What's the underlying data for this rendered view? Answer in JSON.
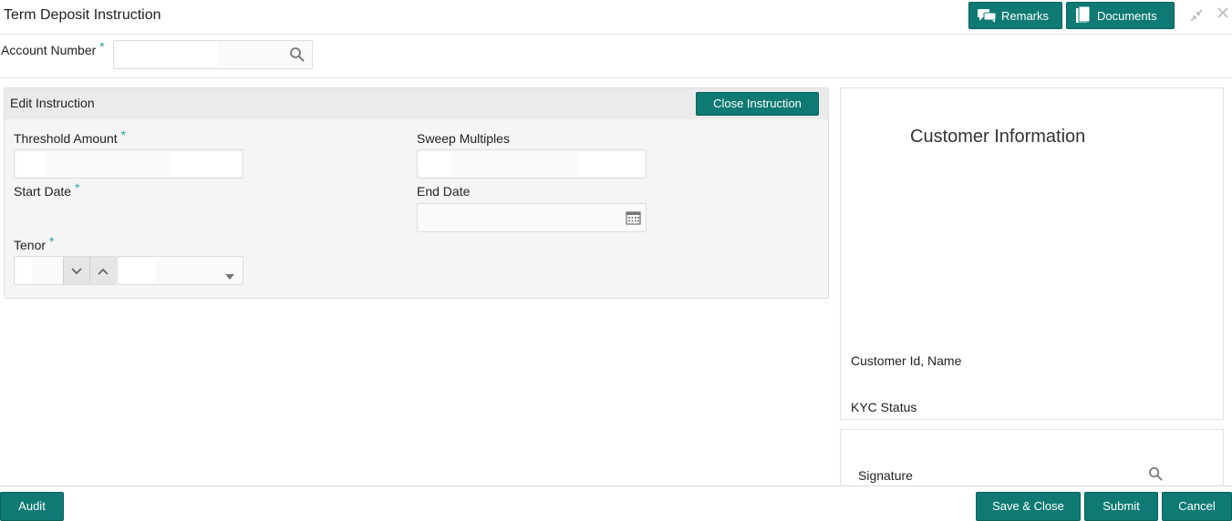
{
  "window": {
    "title": "Term Deposit Instruction",
    "remarks_label": "Remarks",
    "documents_label": "Documents",
    "minimize_icon": "collapse-arrows-icon",
    "close_icon": "close-icon"
  },
  "account": {
    "label": "Account Number",
    "required_mark": "*",
    "value": "",
    "search_icon": "search-icon"
  },
  "edit_instruction": {
    "title": "Edit Instruction",
    "close_button_label": "Close Instruction",
    "threshold_amount": {
      "label": "Threshold Amount",
      "required_mark": "*",
      "value": ""
    },
    "sweep_multiples": {
      "label": "Sweep Multiples",
      "value": ""
    },
    "start_date": {
      "label": "Start Date",
      "required_mark": "*"
    },
    "end_date": {
      "label": "End Date",
      "value": "",
      "calendar_icon": "calendar-icon"
    },
    "tenor": {
      "label": "Tenor",
      "required_mark": "*",
      "value": "",
      "unit": ""
    }
  },
  "customer_info": {
    "title": "Customer Information",
    "customer_id_label": "Customer Id, Name",
    "kyc_status_label": "KYC Status",
    "signature_label": "Signature"
  },
  "footer": {
    "audit_label": "Audit",
    "save_close_label": "Save & Close",
    "submit_label": "Submit",
    "cancel_label": "Cancel"
  },
  "colors": {
    "accent": "#0f7a74",
    "required_mark": "#2aa6a0"
  }
}
